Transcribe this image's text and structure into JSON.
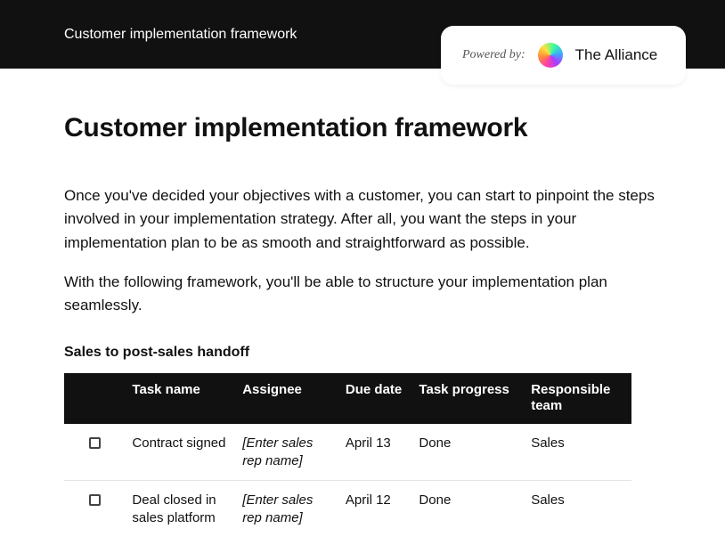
{
  "topbar": {
    "title": "Customer implementation framework"
  },
  "powered": {
    "label": "Powered by:",
    "brand": "The Alliance"
  },
  "page": {
    "title": "Customer implementation framework",
    "intro1": "Once you've decided your objectives with a customer, you can start to pinpoint the steps involved in your implementation strategy. After all, you want the steps in your implementation plan to be as smooth and straightforward as possible.",
    "intro2": "With the following framework, you'll be able to structure your implementation plan seamlessly."
  },
  "section": {
    "heading": "Sales to post-sales handoff",
    "columns": {
      "task": "Task name",
      "assignee": "Assignee",
      "due": "Due date",
      "progress": "Task progress",
      "team": "Responsible team"
    },
    "rows": [
      {
        "task": "Contract signed",
        "assignee": "[Enter sales rep name]",
        "due": "April 13",
        "progress": "Done",
        "team": "Sales"
      },
      {
        "task": "Deal closed in sales platform",
        "assignee": "[Enter sales rep name]",
        "due": "April 12",
        "progress": "Done",
        "team": "Sales"
      }
    ]
  }
}
